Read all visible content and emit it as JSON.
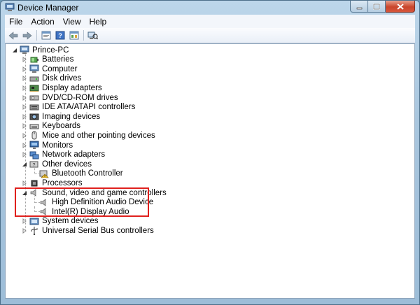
{
  "window": {
    "title": "Device Manager"
  },
  "menu": [
    "File",
    "Action",
    "View",
    "Help"
  ],
  "toolbar": [
    "back-icon",
    "forward-icon",
    "properties-icon",
    "help-icon",
    "show-hidden-icon",
    "scan-hardware-icon"
  ],
  "tree": {
    "root": "Prince-PC",
    "categories": [
      {
        "label": "Batteries",
        "icon": "battery-icon"
      },
      {
        "label": "Computer",
        "icon": "computer-icon"
      },
      {
        "label": "Disk drives",
        "icon": "disk-drive-icon"
      },
      {
        "label": "Display adapters",
        "icon": "display-adapter-icon"
      },
      {
        "label": "DVD/CD-ROM drives",
        "icon": "dvd-drive-icon"
      },
      {
        "label": "IDE ATA/ATAPI controllers",
        "icon": "ide-controller-icon"
      },
      {
        "label": "Imaging devices",
        "icon": "camera-icon"
      },
      {
        "label": "Keyboards",
        "icon": "keyboard-icon"
      },
      {
        "label": "Mice and other pointing devices",
        "icon": "mouse-icon"
      },
      {
        "label": "Monitors",
        "icon": "monitor-icon"
      },
      {
        "label": "Network adapters",
        "icon": "network-adapter-icon"
      },
      {
        "label": "Other devices",
        "icon": "other-devices-icon"
      },
      {
        "label": "Bluetooth Controller",
        "icon": "warning-device-icon"
      },
      {
        "label": "Processors",
        "icon": "processor-icon"
      },
      {
        "label": "Sound, video and game controllers",
        "icon": "speaker-icon"
      },
      {
        "label": "High Definition Audio Device",
        "icon": "speaker-icon"
      },
      {
        "label": "Intel(R) Display Audio",
        "icon": "speaker-icon"
      },
      {
        "label": "System devices",
        "icon": "system-device-icon"
      },
      {
        "label": "Universal Serial Bus controllers",
        "icon": "usb-icon"
      }
    ]
  },
  "colors": {
    "highlight": "#e0201d",
    "title_bar": "#bcd6ea"
  }
}
